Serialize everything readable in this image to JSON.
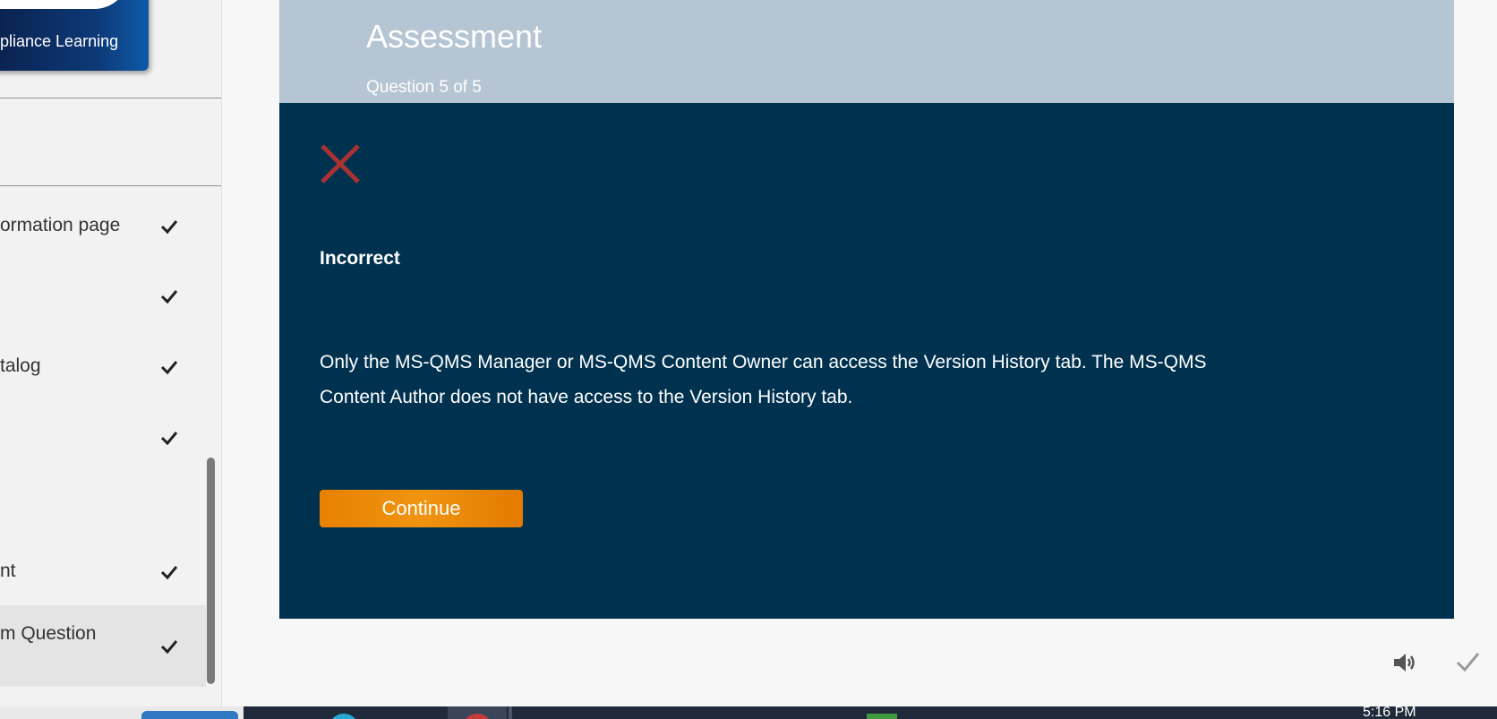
{
  "sidebar": {
    "logo_text": "pliance Learning",
    "items": [
      {
        "label": "ormation page",
        "completed": true
      },
      {
        "label": "",
        "completed": true
      },
      {
        "label": "talog",
        "completed": true
      },
      {
        "label": "",
        "completed": true
      },
      {
        "label": "",
        "completed": false
      },
      {
        "label": "nt",
        "completed": true
      },
      {
        "label": "m Question",
        "completed": true,
        "active": true
      }
    ]
  },
  "assessment": {
    "title": "Assessment",
    "progress": "Question 5 of 5",
    "result_icon": "x-icon",
    "result_title": "Incorrect",
    "feedback": "Only the MS-QMS Manager or MS-QMS Content Owner can access the Version History tab. The MS-QMS Content Author does not have access to the Version History tab.",
    "continue_label": "Continue"
  },
  "controls": {
    "audio_icon": "speaker-icon",
    "done_icon": "checkmark-icon"
  },
  "taskbar": {
    "time": "5:16 PM"
  },
  "colors": {
    "header": "#b6c5d3",
    "panel": "#00324f",
    "accent_orange": "#e88100",
    "incorrect_red": "#a83232"
  }
}
